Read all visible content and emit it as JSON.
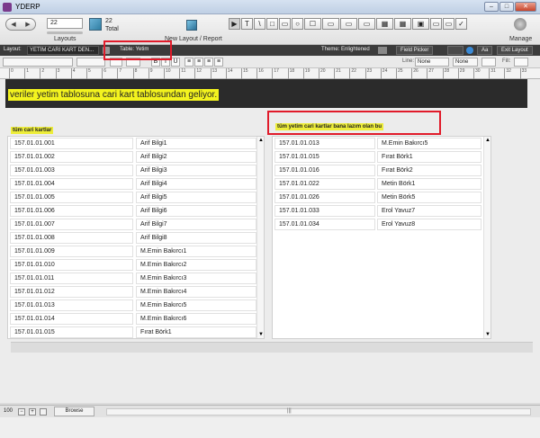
{
  "window": {
    "title": "YDERP"
  },
  "toolbar": {
    "record_value": "22",
    "total_count": "22",
    "total_label": "Total",
    "layouts_label": "Layouts",
    "new_layout_label": "New Layout / Report",
    "manage_label": "Manage",
    "tools": [
      "▶",
      "T",
      "\\",
      "□",
      "▭",
      "○",
      "☐",
      "▭",
      "▭",
      "▭",
      "▦",
      "▦",
      "▣",
      "▭",
      "▭",
      "✓"
    ]
  },
  "layout_bar": {
    "layout_label": "Layout:",
    "layout_value": "YETİM CARİ KART DEN...",
    "table_label": "Table: Yetim",
    "theme_label": "Theme: Enlightened",
    "field_picker": "Field Picker",
    "aa": "Aa",
    "exit_layout": "Exit Layout"
  },
  "format_bar": {
    "line_label": "Line:",
    "line_value": "None",
    "none_value": "None",
    "fill_label": "Fill:"
  },
  "ruler": {
    "ticks": [
      "0",
      "1",
      "2",
      "3",
      "4",
      "5",
      "6",
      "7",
      "8",
      "9",
      "10",
      "11",
      "12",
      "13",
      "14",
      "15",
      "16",
      "17",
      "18",
      "19",
      "20",
      "21",
      "22",
      "23",
      "24",
      "25",
      "26",
      "27",
      "28",
      "29",
      "30",
      "31",
      "32",
      "33"
    ]
  },
  "content": {
    "note": "veriler yetim tablosuna cari kart tablosundan geliyor.",
    "left_title": "tüm cari kartlar",
    "right_title": "tüm yetim cari kartlar bana lazım olan bu",
    "left_rows": [
      {
        "code": "157.01.01.001",
        "name": "Arif Bilgi1"
      },
      {
        "code": "157.01.01.002",
        "name": "Arif Bilgi2"
      },
      {
        "code": "157.01.01.003",
        "name": "Arif Bilgi3"
      },
      {
        "code": "157.01.01.004",
        "name": "Arif Bilgi4"
      },
      {
        "code": "157.01.01.005",
        "name": "Arif Bilgi5"
      },
      {
        "code": "157.01.01.006",
        "name": "Arif Bilgi6"
      },
      {
        "code": "157.01.01.007",
        "name": "Arif Bilgi7"
      },
      {
        "code": "157.01.01.008",
        "name": "Arif Bilgi8"
      },
      {
        "code": "157.01.01.009",
        "name": "M.Emin Bakırcı1"
      },
      {
        "code": "157.01.01.010",
        "name": "M.Emin Bakırcı2"
      },
      {
        "code": "157.01.01.011",
        "name": "M.Emin Bakırcı3"
      },
      {
        "code": "157.01.01.012",
        "name": "M.Emin Bakırcı4"
      },
      {
        "code": "157.01.01.013",
        "name": "M.Emin Bakırcı5"
      },
      {
        "code": "157.01.01.014",
        "name": "M.Emin Bakırcı6"
      },
      {
        "code": "157.01.01.015",
        "name": "Fırat Börk1"
      }
    ],
    "right_rows": [
      {
        "code": "157.01.01.013",
        "name": "M.Emin Bakırcı5"
      },
      {
        "code": "157.01.01.015",
        "name": "Fırat Börk1"
      },
      {
        "code": "157.01.01.016",
        "name": "Fırat Börk2"
      },
      {
        "code": "157.01.01.022",
        "name": "Metin Börk1"
      },
      {
        "code": "157.01.01.026",
        "name": "Metin Börk5"
      },
      {
        "code": "157.01.01.033",
        "name": "Erol Yavuz7"
      },
      {
        "code": "157.01.01.034",
        "name": "Erol Yavuz8"
      }
    ]
  },
  "status_bar": {
    "zoom": "100",
    "mode": "Browse"
  }
}
